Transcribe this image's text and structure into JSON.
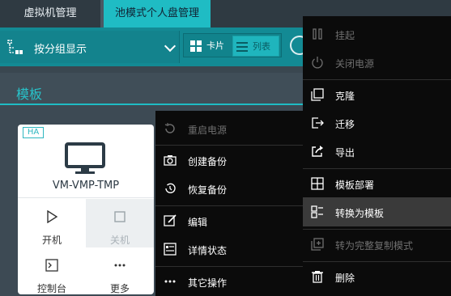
{
  "tabs": [
    {
      "label": "虚拟机管理"
    },
    {
      "label": "池模式个人盘管理"
    }
  ],
  "toolbar": {
    "group_label": "按分组显示",
    "card_label": "卡片",
    "list_label": "列表"
  },
  "section": {
    "title": "模板"
  },
  "vm_card": {
    "badge": "HA",
    "name": "VM-VMP-TMP",
    "actions": [
      {
        "label": "开机",
        "icon": "play-icon",
        "disabled": false
      },
      {
        "label": "关机",
        "icon": "stop-icon",
        "disabled": true
      },
      {
        "label": "控制台",
        "icon": "console-icon",
        "disabled": false
      },
      {
        "label": "更多",
        "icon": "more-icon",
        "disabled": false
      }
    ]
  },
  "menu_more": {
    "items": [
      {
        "label": "重启电源",
        "icon": "restart-icon",
        "disabled": true
      },
      {
        "label": "创建备份",
        "icon": "camera-icon",
        "disabled": false
      },
      {
        "label": "恢复备份",
        "icon": "history-icon",
        "disabled": false
      },
      {
        "label": "编辑",
        "icon": "edit-icon",
        "disabled": false
      },
      {
        "label": "详情状态",
        "icon": "details-icon",
        "disabled": false
      },
      {
        "label": "其它操作",
        "icon": "ellipsis-icon",
        "disabled": false
      }
    ]
  },
  "menu_other": {
    "items": [
      {
        "label": "挂起",
        "icon": "pause-icon",
        "disabled": true
      },
      {
        "label": "关闭电源",
        "icon": "power-icon",
        "disabled": true
      },
      {
        "label": "克隆",
        "icon": "clone-icon",
        "disabled": false
      },
      {
        "label": "迁移",
        "icon": "migrate-icon",
        "disabled": false
      },
      {
        "label": "导出",
        "icon": "export-icon",
        "disabled": false
      },
      {
        "label": "模板部署",
        "icon": "grid-icon",
        "disabled": false
      },
      {
        "label": "转换为模板",
        "icon": "convert-template-icon",
        "disabled": false,
        "highlighted": true
      },
      {
        "label": "转为完整复制模式",
        "icon": "full-copy-icon",
        "disabled": true
      },
      {
        "label": "删除",
        "icon": "trash-icon",
        "disabled": false
      }
    ]
  },
  "colors": {
    "accent": "#1fbcc4",
    "toolbar": "#138a94",
    "background": "#3d4a54",
    "menu": "#0b0b0b"
  }
}
